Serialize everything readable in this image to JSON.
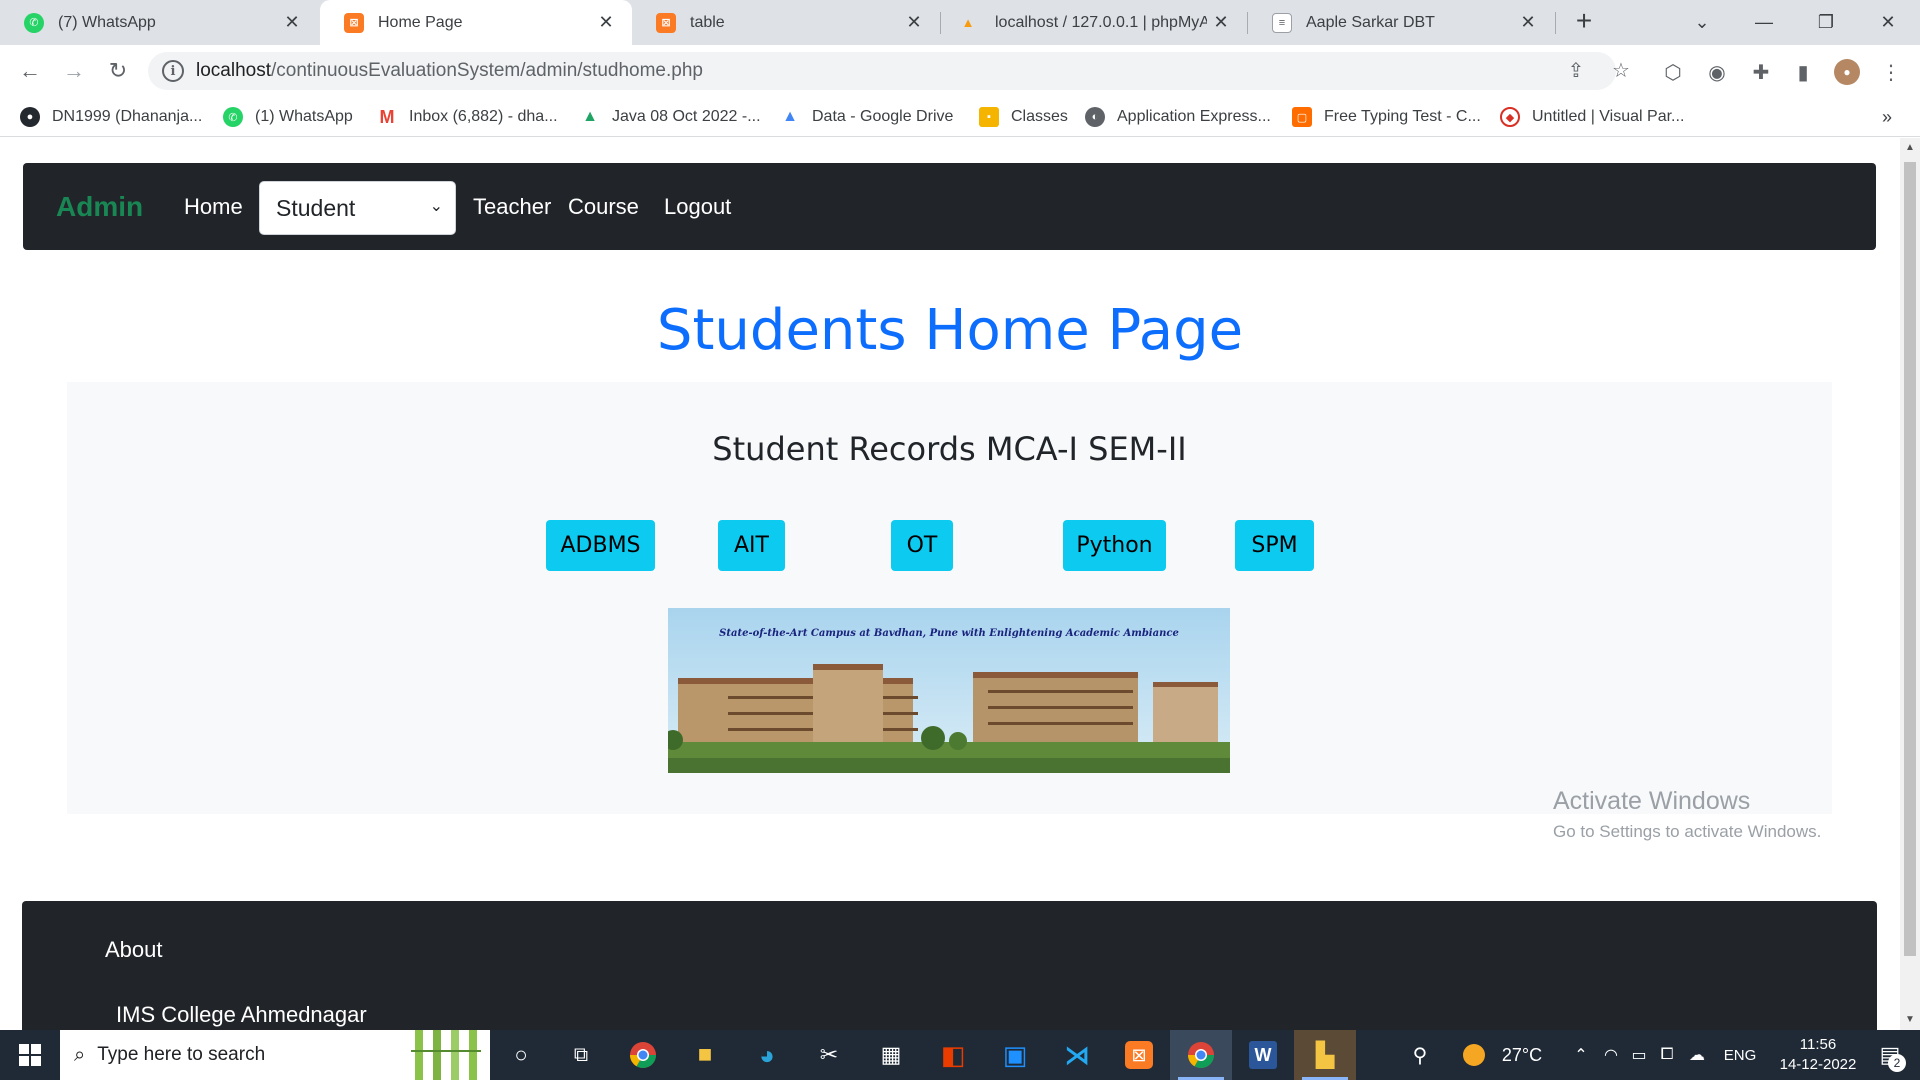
{
  "browser": {
    "tabs": [
      {
        "title": "(7) WhatsApp",
        "favicon": "whatsapp-icon",
        "active": false
      },
      {
        "title": "Home Page",
        "favicon": "xampp-icon",
        "active": true
      },
      {
        "title": "table",
        "favicon": "xampp-icon",
        "active": false
      },
      {
        "title": "localhost / 127.0.0.1 | phpMyA",
        "favicon": "phpmyadmin-icon",
        "active": false
      },
      {
        "title": "Aaple Sarkar DBT",
        "favicon": "document-icon",
        "active": false
      }
    ],
    "url_host": "localhost",
    "url_path": "/continuousEvaluationSystem/admin/studhome.php",
    "bookmarks": [
      {
        "label": "DN1999 (Dhananja...",
        "icon": "github-icon"
      },
      {
        "label": "(1) WhatsApp",
        "icon": "whatsapp-icon"
      },
      {
        "label": "Inbox (6,882) - dha...",
        "icon": "gmail-icon"
      },
      {
        "label": "Java 08 Oct 2022 -...",
        "icon": "drive-icon"
      },
      {
        "label": "Data - Google Drive",
        "icon": "drive-icon"
      },
      {
        "label": "Classes",
        "icon": "classroom-icon"
      },
      {
        "label": "Application Express...",
        "icon": "globe-icon"
      },
      {
        "label": "Free Typing Test - C...",
        "icon": "typing-icon"
      },
      {
        "label": "Untitled | Visual Par...",
        "icon": "visual-paradigm-icon"
      }
    ]
  },
  "navbar": {
    "brand": "Admin",
    "home": "Home",
    "select_value": "Student",
    "teacher": "Teacher",
    "course": "Course",
    "logout": "Logout"
  },
  "page": {
    "title": "Students Home Page",
    "panel_title": "Student Records MCA-I SEM-II",
    "subjects": [
      "ADBMS",
      "AIT",
      "OT",
      "Python",
      "SPM"
    ],
    "campus_caption": "State-of-the-Art Campus at Bavdhan, Pune with Enlightening Academic Ambiance"
  },
  "footer": {
    "about": "About",
    "college": "IMS College Ahmednagar"
  },
  "watermark": {
    "line1": "Activate Windows",
    "line2": "Go to Settings to activate Windows."
  },
  "taskbar": {
    "search_placeholder": "Type here to search",
    "temperature": "27°C",
    "language": "ENG",
    "time": "11:56",
    "date": "14-12-2022",
    "notifications": "2"
  },
  "colors": {
    "brand_green": "#198754",
    "title_blue": "#0d6efd",
    "button_cyan": "#0dcaf0",
    "navbar_dark": "#212529"
  }
}
